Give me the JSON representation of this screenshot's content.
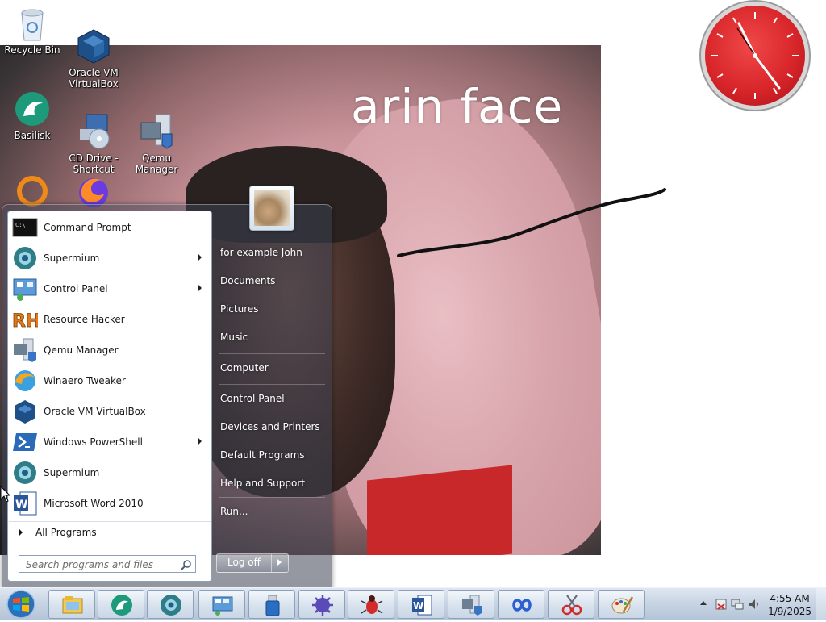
{
  "desktop": {
    "icons": [
      {
        "label": "Recycle Bin",
        "icon": "recycle-bin-icon"
      },
      {
        "label": "Oracle VM\nVirtualBox",
        "icon": "virtualbox-icon"
      },
      {
        "label": "Basilisk",
        "icon": "basilisk-icon"
      },
      {
        "label": "CD Drive -\nShortcut",
        "icon": "cd-drive-icon"
      },
      {
        "label": "Qemu\nManager",
        "icon": "qemu-manager-icon"
      },
      {
        "label": "",
        "icon": "orange-ring-icon"
      },
      {
        "label": "",
        "icon": "firefox-icon"
      }
    ],
    "wallpaper_caption": "arin face"
  },
  "start_menu": {
    "programs": [
      {
        "label": "Command Prompt",
        "icon": "command-prompt-icon",
        "submenu": false
      },
      {
        "label": "Supermium",
        "icon": "supermium-icon",
        "submenu": true
      },
      {
        "label": "Control Panel",
        "icon": "control-panel-icon",
        "submenu": true
      },
      {
        "label": "Resource Hacker",
        "icon": "resource-hacker-icon",
        "submenu": false
      },
      {
        "label": "Qemu Manager",
        "icon": "qemu-manager-icon",
        "submenu": false
      },
      {
        "label": "Winaero Tweaker",
        "icon": "winaero-tweaker-icon",
        "submenu": false
      },
      {
        "label": "Oracle VM VirtualBox",
        "icon": "virtualbox-icon",
        "submenu": false
      },
      {
        "label": "Windows PowerShell",
        "icon": "powershell-icon",
        "submenu": true
      },
      {
        "label": "Supermium",
        "icon": "supermium-icon",
        "submenu": false
      },
      {
        "label": "Microsoft Word 2010",
        "icon": "word-icon",
        "submenu": false
      }
    ],
    "all_programs": "All Programs",
    "search_placeholder": "Search programs and files",
    "right_links": [
      "for example John",
      "Documents",
      "Pictures",
      "Music",
      "Computer",
      "Control Panel",
      "Devices and Printers",
      "Default Programs",
      "Help and Support",
      "Run..."
    ],
    "log_off": "Log off"
  },
  "taskbar": {
    "pinned": [
      "explorer-icon",
      "basilisk-icon",
      "supermium-icon",
      "control-panel-icon",
      "usb-drive-icon",
      "virus-icon",
      "bug-icon",
      "word-icon",
      "qemu-manager-icon",
      "infinity-icon",
      "snipping-tool-icon",
      "paint-icon"
    ],
    "time": "4:55 AM",
    "date": "1/9/2025"
  },
  "colors": {
    "clock_face": "#d8262b",
    "taskbar": "#c6d3e2"
  }
}
